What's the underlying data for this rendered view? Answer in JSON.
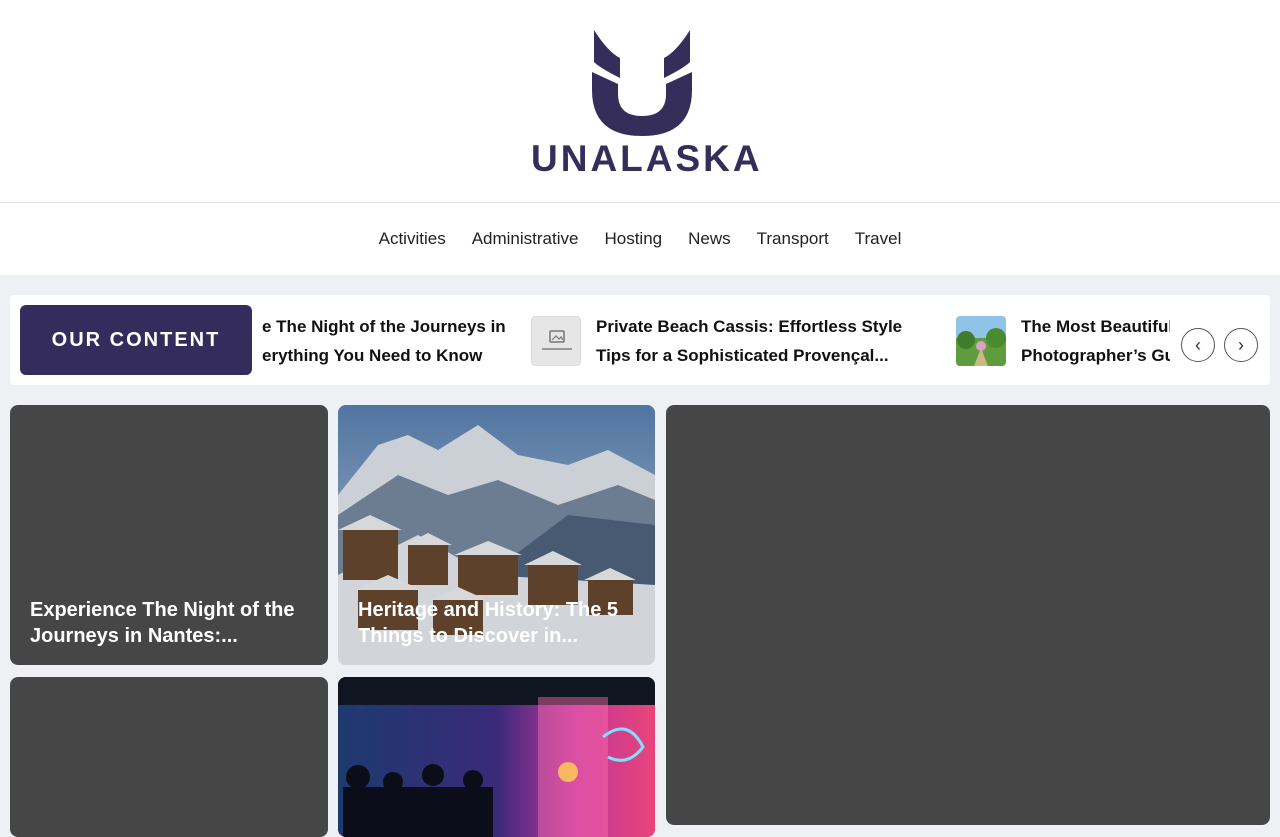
{
  "brand": {
    "name": "UNALASKA",
    "primary_color": "#352e5a"
  },
  "nav": {
    "items": [
      "Activities",
      "Administrative",
      "Hosting",
      "News",
      "Transport",
      "Travel"
    ]
  },
  "ticker": {
    "badge": "OUR CONTENT",
    "items": [
      {
        "line1": "e The Night of the Journeys in",
        "line2": "erything You Need to Know"
      },
      {
        "line1": "Private Beach Cassis: Effortless Style",
        "line2": "Tips for a Sophisticated Provençal..."
      },
      {
        "line1": "The Most Beautiful",
        "line2": "Photographer’s Gu"
      }
    ],
    "prev_icon": "chevron-left-icon",
    "next_icon": "chevron-right-icon"
  },
  "cards": [
    {
      "line1": "Experience The Night of the",
      "line2": "Journeys in Nantes:..."
    },
    {
      "line1": "Heritage and History: The 5",
      "line2": "Things to Discover in..."
    }
  ]
}
